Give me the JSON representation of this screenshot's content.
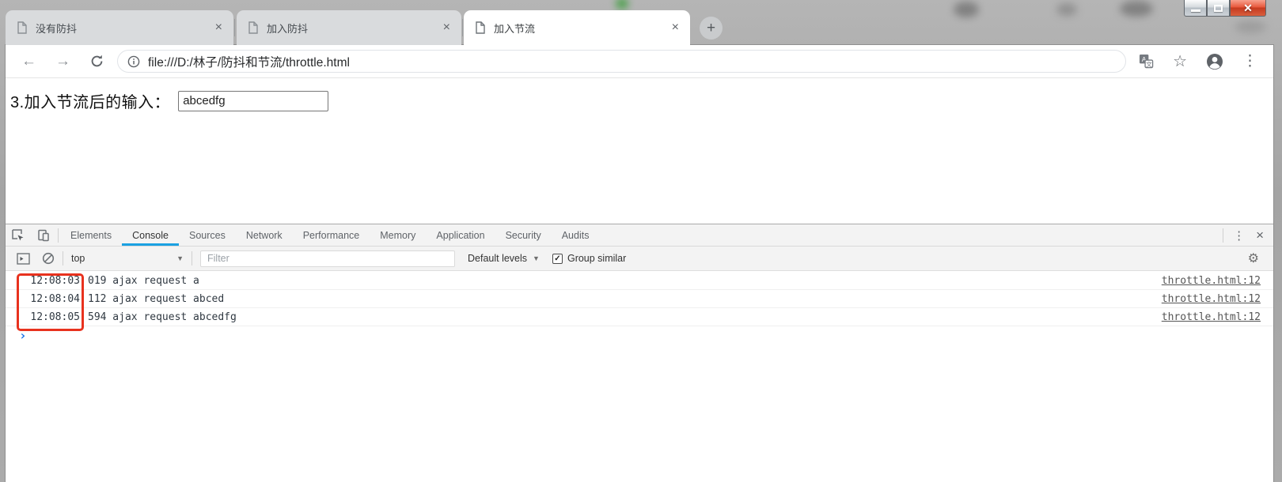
{
  "window": {
    "controls": {
      "minimize": "minimize",
      "maximize": "maximize",
      "close_glyph": "✕"
    }
  },
  "tab_strip": {
    "tabs": [
      {
        "title": "没有防抖",
        "close_glyph": "×",
        "active": false
      },
      {
        "title": "加入防抖",
        "close_glyph": "×",
        "active": false
      },
      {
        "title": "加入节流",
        "close_glyph": "×",
        "active": true
      }
    ],
    "new_tab_glyph": "+"
  },
  "toolbar": {
    "back_glyph": "←",
    "forward_glyph": "→",
    "url": "file:///D:/林子/防抖和节流/throttle.html",
    "star_glyph": "☆",
    "menu_glyph": "⋮"
  },
  "page": {
    "label": "3.加入节流后的输入：",
    "input_value": "abcedfg"
  },
  "devtools": {
    "tabs": [
      "Elements",
      "Console",
      "Sources",
      "Network",
      "Performance",
      "Memory",
      "Application",
      "Security",
      "Audits"
    ],
    "active_tab": "Console",
    "tabbar_menu_glyph": "⋮",
    "tabbar_close_glyph": "×",
    "toolbar": {
      "context": "top",
      "caret_glyph": "▼",
      "filter_placeholder": "Filter",
      "levels_label": "Default levels",
      "group_similar_label": "Group similar",
      "group_similar_checked": true,
      "checkbox_glyph": "✓",
      "gear_glyph": "⚙"
    },
    "logs": [
      {
        "time": "12:08:03",
        "text": "019 ajax request a",
        "source": "throttle.html:12"
      },
      {
        "time": "12:08:04",
        "text": "112 ajax request abced",
        "source": "throttle.html:12"
      },
      {
        "time": "12:08:05",
        "text": "594 ajax request abcedfg",
        "source": "throttle.html:12"
      }
    ],
    "prompt_glyph": "›"
  },
  "colors": {
    "accent_tab_underline": "#1ba1e2",
    "annotation_red": "#e8321e",
    "close_button_red": "#d64b2c",
    "devtools_bg": "#f3f3f3",
    "inactive_tab": "#d9dbdd"
  }
}
